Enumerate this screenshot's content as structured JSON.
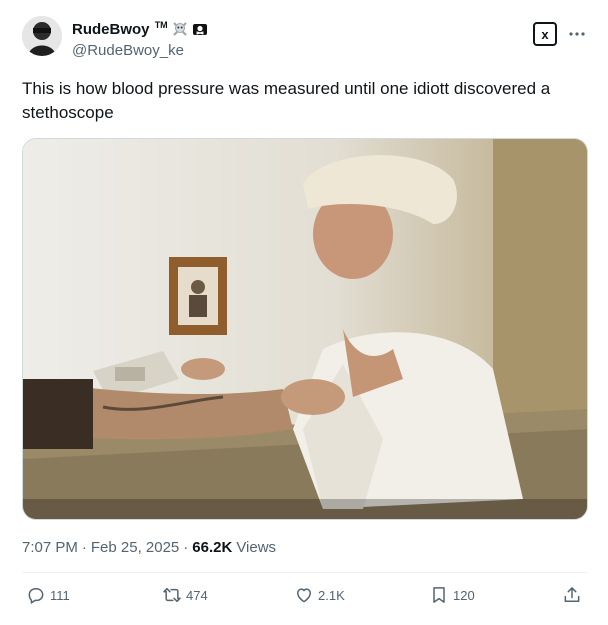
{
  "author": {
    "display_name": "RudeBwoy",
    "tm": "TM",
    "handle": "@RudeBwoy_ke",
    "emoji_names": [
      "skull-crossbones-icon",
      "pirate-flag-icon"
    ]
  },
  "header_actions": {
    "grok_label": "x",
    "more_icon": "more-horizontal-icon"
  },
  "tweet": {
    "text": "This is how blood pressure was measured until one idiott discovered a stethoscope"
  },
  "media": {
    "type": "video-still"
  },
  "meta": {
    "time": "7:07 PM",
    "separator": "·",
    "date": "Feb 25, 2025",
    "views_count": "66.2K",
    "views_label": "Views"
  },
  "actions": {
    "reply_count": "111",
    "repost_count": "474",
    "like_count": "2.1K",
    "bookmark_count": "120"
  },
  "colors": {
    "text_primary": "#0f1419",
    "text_secondary": "#536471",
    "divider": "#eff3f4"
  }
}
